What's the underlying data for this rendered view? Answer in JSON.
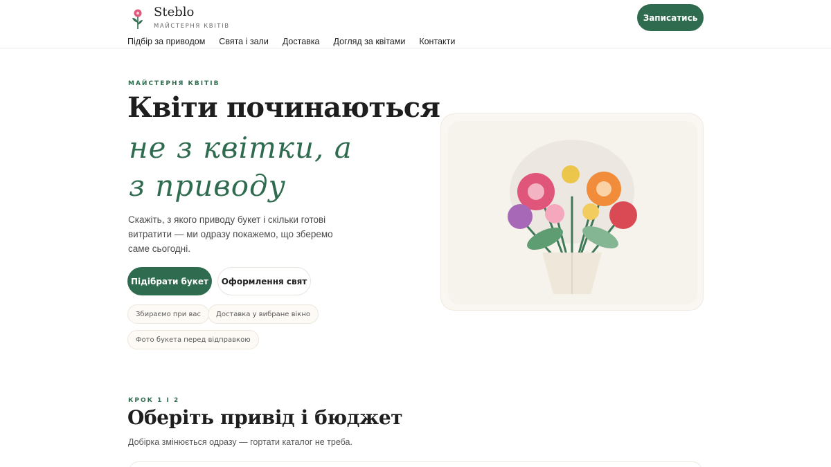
{
  "brand": {
    "name": "Steblo",
    "tagline": "МАЙСТЕРНЯ КВІТІВ"
  },
  "header": {
    "cta_label": "Записатись"
  },
  "nav": {
    "items": [
      "Підбір за приводом",
      "Свята і зали",
      "Доставка",
      "Догляд за квітами",
      "Контакти"
    ]
  },
  "hero": {
    "eyebrow": "МАЙСТЕРНЯ КВІТІВ",
    "title": "Квіти починаються",
    "script_line1": "не з квітки, а",
    "script_line2": "з приводу",
    "description": "Скажіть, з якого приводу букет і скільки готові витратити — ми одразу покажемо, що зберемо саме сьогодні.",
    "primary_button": "Підібрати букет",
    "secondary_button": "Оформлення свят",
    "chips": [
      "Збираємо при вас",
      "Доставка у вибране вікно",
      "Фото букета перед відправкою"
    ]
  },
  "step": {
    "eyebrow": "КРОК 1 І 2",
    "title": "Оберіть привід і бюджет",
    "description": "Добірка змінюється одразу — гортати каталог не треба."
  },
  "colors": {
    "accent": "#2f6b4e",
    "flower_pink": "#e0557a",
    "flower_orange": "#f08c3a",
    "flower_red": "#d94a55",
    "flower_purple": "#a868b8",
    "flower_yellow": "#ecc64a",
    "leaf": "#6ea67e"
  }
}
